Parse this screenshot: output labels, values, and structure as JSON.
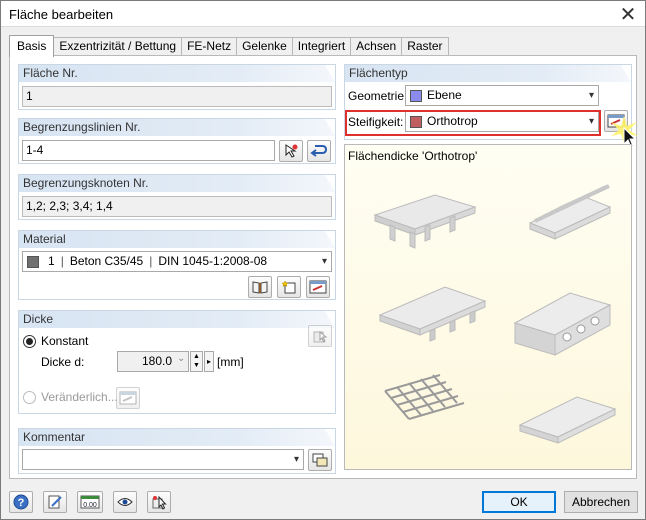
{
  "window": {
    "title": "Fläche bearbeiten"
  },
  "tabs": [
    {
      "label": "Basis"
    },
    {
      "label": "Exzentrizität / Bettung"
    },
    {
      "label": "FE-Netz"
    },
    {
      "label": "Gelenke"
    },
    {
      "label": "Integriert"
    },
    {
      "label": "Achsen"
    },
    {
      "label": "Raster"
    }
  ],
  "flaeche_nr": {
    "header": "Fläche Nr.",
    "value": "1"
  },
  "begrenzungslinien": {
    "header": "Begrenzungslinien Nr.",
    "value": "1-4"
  },
  "begrenzungsknoten": {
    "header": "Begrenzungsknoten Nr.",
    "value": "1,2; 2,3; 3,4; 1,4"
  },
  "material": {
    "header": "Material",
    "number": "1",
    "name": "Beton C35/45",
    "norm": "DIN 1045-1:2008-08",
    "swatch_color": "#707070"
  },
  "dicke": {
    "header": "Dicke",
    "konstant_label": "Konstant",
    "dicke_label": "Dicke d:",
    "dicke_value": "180.0",
    "unit": "[mm]",
    "veraenderlich_label": "Veränderlich..."
  },
  "kommentar": {
    "header": "Kommentar",
    "value": ""
  },
  "flaechentyp": {
    "header": "Flächentyp",
    "geometrie_label": "Geometrie:",
    "geometrie_value": "Ebene",
    "geometrie_color": "#8c8cf0",
    "steifigkeit_label": "Steifigkeit:",
    "steifigkeit_value": "Orthotrop",
    "steifigkeit_color": "#c06060",
    "highlight_color": "#e0302b"
  },
  "preview": {
    "title": "Flächendicke 'Orthotrop'"
  },
  "buttons": {
    "ok": "OK",
    "cancel": "Abbrechen"
  },
  "bottom_toolbar_icons": [
    "help-icon",
    "edit-icon",
    "numeric-icon",
    "view-icon",
    "select-icon"
  ]
}
